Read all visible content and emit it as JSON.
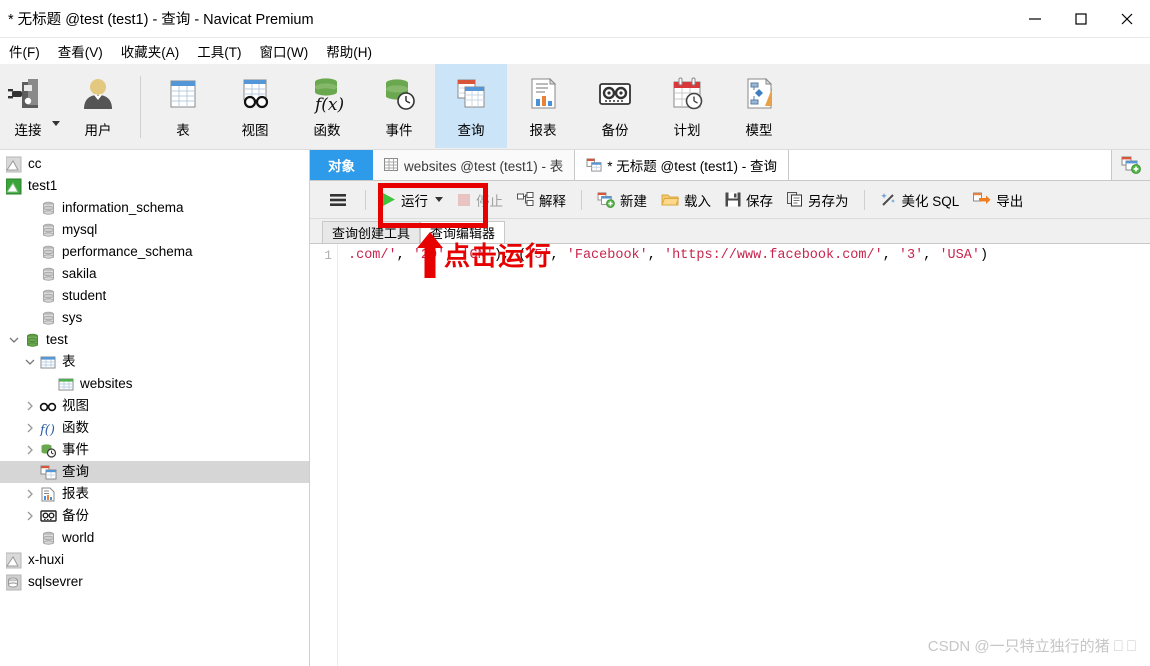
{
  "window": {
    "title": "* 无标题 @test (test1) - 查询 - Navicat Premium",
    "controls": {
      "minimize": "minimize-icon",
      "maximize": "maximize-icon",
      "close": "close-icon"
    }
  },
  "menubar": {
    "items": [
      {
        "label": "件(F)",
        "key": "F"
      },
      {
        "label": "查看(V)",
        "key": "V"
      },
      {
        "label": "收藏夹(A)",
        "key": "A"
      },
      {
        "label": "工具(T)",
        "key": "T"
      },
      {
        "label": "窗口(W)",
        "key": "W"
      },
      {
        "label": "帮助(H)",
        "key": "H"
      }
    ]
  },
  "toolbar": {
    "items": [
      {
        "label": "连接",
        "icon": "connection-plug-icon",
        "selected": false
      },
      {
        "label": "用户",
        "icon": "user-icon",
        "selected": false
      },
      {
        "label": "表",
        "icon": "table-icon",
        "selected": false
      },
      {
        "label": "视图",
        "icon": "view-glasses-icon",
        "selected": false
      },
      {
        "label": "函数",
        "icon": "function-fx-icon",
        "selected": false
      },
      {
        "label": "事件",
        "icon": "event-clock-icon",
        "selected": false
      },
      {
        "label": "查询",
        "icon": "query-icon",
        "selected": true
      },
      {
        "label": "报表",
        "icon": "report-icon",
        "selected": false
      },
      {
        "label": "备份",
        "icon": "backup-cassette-icon",
        "selected": false
      },
      {
        "label": "计划",
        "icon": "schedule-calendar-icon",
        "selected": false
      },
      {
        "label": "模型",
        "icon": "model-diagram-icon",
        "selected": false
      }
    ]
  },
  "sidebar": {
    "items": [
      {
        "label": "cc",
        "icon": "connection-gray-icon",
        "indent": 0,
        "twisty": "none",
        "selected": false
      },
      {
        "label": "test1",
        "icon": "connection-green-icon",
        "indent": 0,
        "twisty": "none",
        "selected": false
      },
      {
        "label": "information_schema",
        "icon": "database-gray-icon",
        "indent": 1,
        "twisty": "none",
        "selected": false
      },
      {
        "label": "mysql",
        "icon": "database-gray-icon",
        "indent": 1,
        "twisty": "none",
        "selected": false
      },
      {
        "label": "performance_schema",
        "icon": "database-gray-icon",
        "indent": 1,
        "twisty": "none",
        "selected": false
      },
      {
        "label": "sakila",
        "icon": "database-gray-icon",
        "indent": 1,
        "twisty": "none",
        "selected": false
      },
      {
        "label": "student",
        "icon": "database-gray-icon",
        "indent": 1,
        "twisty": "none",
        "selected": false
      },
      {
        "label": "sys",
        "icon": "database-gray-icon",
        "indent": 1,
        "twisty": "none",
        "selected": false
      },
      {
        "label": "test",
        "icon": "database-green-icon",
        "indent": 1,
        "twisty": "expanded",
        "selected": false
      },
      {
        "label": "表",
        "icon": "table-icon",
        "indent": 2,
        "twisty": "expanded",
        "selected": false
      },
      {
        "label": "websites",
        "icon": "table-icon",
        "indent": 3,
        "twisty": "none",
        "selected": false
      },
      {
        "label": "视图",
        "icon": "view-glasses-icon",
        "indent": 2,
        "twisty": "collapsed",
        "selected": false
      },
      {
        "label": "函数",
        "icon": "function-fx-icon",
        "indent": 2,
        "twisty": "collapsed",
        "selected": false
      },
      {
        "label": "事件",
        "icon": "event-clock-icon",
        "indent": 2,
        "twisty": "collapsed",
        "selected": false
      },
      {
        "label": "查询",
        "icon": "query-icon",
        "indent": 2,
        "twisty": "none",
        "selected": true
      },
      {
        "label": "报表",
        "icon": "report-icon",
        "indent": 2,
        "twisty": "collapsed",
        "selected": false
      },
      {
        "label": "备份",
        "icon": "backup-cassette-icon",
        "indent": 2,
        "twisty": "collapsed",
        "selected": false
      },
      {
        "label": "world",
        "icon": "database-gray-icon",
        "indent": 1,
        "twisty": "none",
        "selected": false
      },
      {
        "label": "x-huxi",
        "icon": "connection-gray-icon",
        "indent": 0,
        "twisty": "none",
        "selected": false
      },
      {
        "label": "sqlsevrer",
        "icon": "connection-sqlserver-icon",
        "indent": 0,
        "twisty": "none",
        "selected": false
      }
    ]
  },
  "tabs": {
    "object_tab": "对象",
    "items": [
      {
        "label": "websites @test (test1) - 表",
        "icon": "table-icon",
        "active": false
      },
      {
        "label": "* 无标题 @test (test1) - 查询",
        "icon": "query-icon",
        "active": true
      }
    ],
    "add_tab_icon": "new-query-icon"
  },
  "query_toolbar": {
    "menu_icon": "hamburger-menu-icon",
    "buttons": [
      {
        "label": "运行",
        "icon": "run-play-icon",
        "disabled": false,
        "has_dropdown": true
      },
      {
        "label": "停止",
        "icon": "stop-icon",
        "disabled": true,
        "has_dropdown": false
      },
      {
        "label": "解释",
        "icon": "explain-icon",
        "disabled": false,
        "has_dropdown": false
      },
      {
        "label": "新建",
        "icon": "new-query-icon",
        "disabled": false,
        "has_dropdown": false
      },
      {
        "label": "载入",
        "icon": "open-folder-icon",
        "disabled": false,
        "has_dropdown": false
      },
      {
        "label": "保存",
        "icon": "save-floppy-icon",
        "disabled": false,
        "has_dropdown": false
      },
      {
        "label": "另存为",
        "icon": "save-as-icon",
        "disabled": false,
        "has_dropdown": false
      },
      {
        "label": "美化 SQL",
        "icon": "magic-wand-icon",
        "disabled": false,
        "has_dropdown": false
      },
      {
        "label": "导出",
        "icon": "export-arrow-icon",
        "disabled": false,
        "has_dropdown": false
      }
    ]
  },
  "subtabs": [
    {
      "label": "查询创建工具",
      "active": false
    },
    {
      "label": "查询编辑器",
      "active": true
    }
  ],
  "editor": {
    "line_number": "1",
    "code_segments": [
      {
        "text": ".com/'",
        "type": "str"
      },
      {
        "text": ", ",
        "type": "pun"
      },
      {
        "text": "'20'",
        "type": "str"
      },
      {
        "text": ", ",
        "type": "pun"
      },
      {
        "text": "'CN'",
        "type": "str"
      },
      {
        "text": "), (",
        "type": "pun"
      },
      {
        "text": "'5'",
        "type": "str"
      },
      {
        "text": ", ",
        "type": "pun"
      },
      {
        "text": "'Facebook'",
        "type": "str"
      },
      {
        "text": ", ",
        "type": "pun"
      },
      {
        "text": "'https://www.facebook.com/'",
        "type": "str"
      },
      {
        "text": ", ",
        "type": "pun"
      },
      {
        "text": "'3'",
        "type": "str"
      },
      {
        "text": ", ",
        "type": "pun"
      },
      {
        "text": "'USA'",
        "type": "str"
      },
      {
        "text": ")",
        "type": "pun"
      }
    ],
    "full_line": ".com/', '20', 'CN'), ('5', 'Facebook', 'https://www.facebook.com/', '3', 'USA')"
  },
  "annotation": {
    "text": "点击运行",
    "color": "#e60000",
    "highlight_target": "运行",
    "arrow_icon": "up-arrow-annotation-icon"
  },
  "watermark": {
    "text": "CSDN @一只特立独行的猪 ⎕ ⎕"
  },
  "colors": {
    "accent_blue": "#2e9bea",
    "toolbar_selected": "#cce4f7",
    "annotation_red": "#e60000",
    "sql_string": "#c7254e",
    "tree_selected": "#d6d6d6"
  }
}
